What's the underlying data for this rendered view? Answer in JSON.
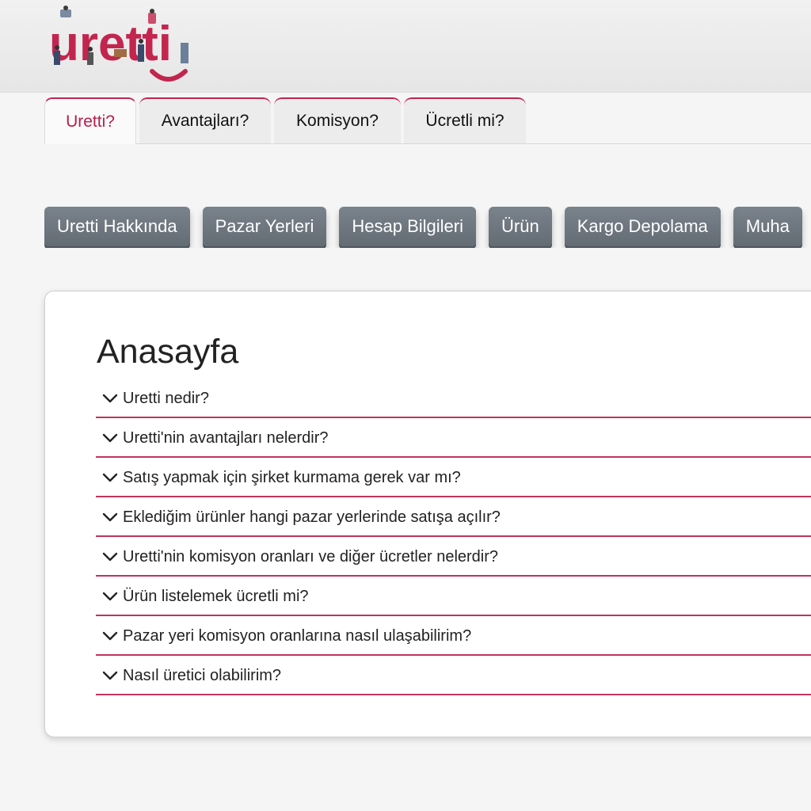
{
  "brand": {
    "logo_text": "uretti",
    "accent_color": "#c2264f",
    "button_color": "#6b737b"
  },
  "tabs": [
    {
      "label": "Uretti?",
      "active": true
    },
    {
      "label": "Avantajları?",
      "active": false
    },
    {
      "label": "Komisyon?",
      "active": false
    },
    {
      "label": "Ücretli mi?",
      "active": false
    }
  ],
  "categories": [
    {
      "label": "Uretti Hakkında"
    },
    {
      "label": "Pazar Yerleri"
    },
    {
      "label": "Hesap Bilgileri"
    },
    {
      "label": "Ürün"
    },
    {
      "label": "Kargo Depolama"
    },
    {
      "label": "Muha"
    }
  ],
  "main": {
    "title": "Anasayfa",
    "faq": [
      {
        "question": "Uretti nedir?",
        "icon": "chevron-down-icon"
      },
      {
        "question": "Uretti'nin avantajları nelerdir?",
        "icon": "chevron-down-icon"
      },
      {
        "question": "Satış yapmak için şirket kurmama gerek var mı?",
        "icon": "chevron-down-icon"
      },
      {
        "question": "Eklediğim ürünler hangi pazar yerlerinde satışa açılır?",
        "icon": "chevron-down-icon"
      },
      {
        "question": "Uretti'nin komisyon oranları ve diğer ücretler nelerdir?",
        "icon": "chevron-down-icon"
      },
      {
        "question": "Ürün listelemek ücretli mi?",
        "icon": "chevron-down-icon"
      },
      {
        "question": "Pazar yeri komisyon oranlarına nasıl ulaşabilirim?",
        "icon": "chevron-down-icon"
      },
      {
        "question": "Nasıl üretici olabilirim?",
        "icon": "chevron-down-icon"
      }
    ]
  }
}
